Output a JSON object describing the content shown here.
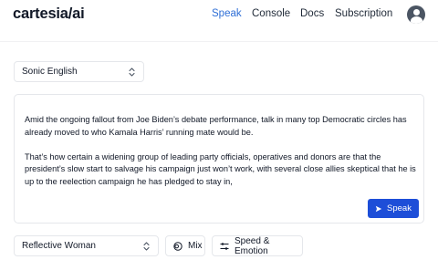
{
  "header": {
    "logo": "cartesia/ai",
    "nav": [
      "Speak",
      "Console",
      "Docs",
      "Subscription"
    ],
    "active_nav": "Speak"
  },
  "model_select": {
    "value": "Sonic English"
  },
  "editor": {
    "paragraphs": [
      "Amid the ongoing fallout from Joe Biden’s debate performance, talk in many top Democratic circles has already moved to who Kamala Harris’ running mate would be.",
      "That’s how certain a widening group of leading party officials, operatives and donors are that the president’s slow start to salvage his campaign just won’t work, with several close allies skeptical that he is up to the reelection campaign he has pledged to stay in,"
    ],
    "speak_label": "Speak"
  },
  "voice_select": {
    "value": "Reflective Woman"
  },
  "controls": {
    "mix_label": "Mix",
    "emotion_label": "Speed & Emotion"
  },
  "colors": {
    "accent": "#2f6fd6",
    "button": "#1d4ed8"
  }
}
